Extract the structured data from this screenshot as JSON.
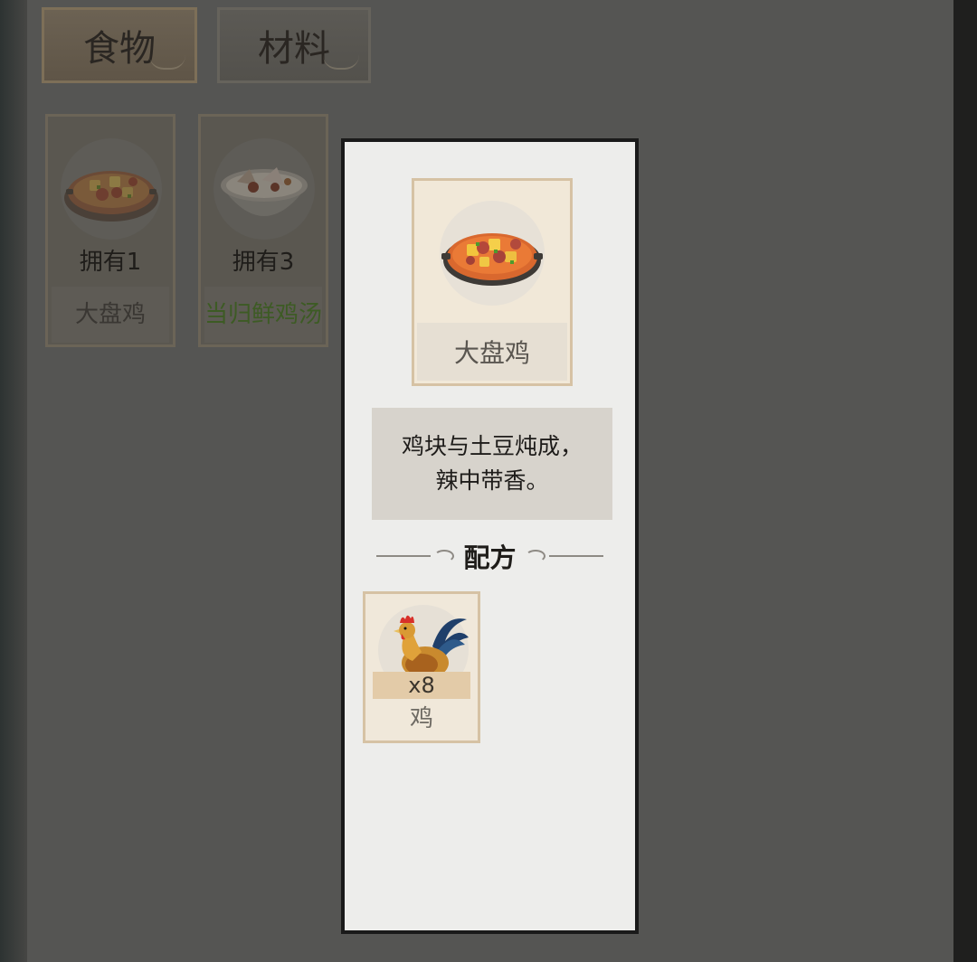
{
  "tabs": [
    {
      "label": "食物",
      "active": true
    },
    {
      "label": "材料",
      "active": false
    }
  ],
  "food_items": [
    {
      "owned": "拥有1",
      "name": "大盘鸡",
      "name_color": "#3a3733",
      "icon": "spicy-chicken-dish-icon"
    },
    {
      "owned": "拥有3",
      "name": "当归鲜鸡汤",
      "name_color": "#3d5b24",
      "icon": "angelica-chicken-soup-icon"
    }
  ],
  "detail": {
    "name": "大盘鸡",
    "icon": "spicy-chicken-dish-icon",
    "description_line1": "鸡块与土豆炖成，",
    "description_line2": "辣中带香。",
    "recipe_heading": "配方",
    "ingredients": [
      {
        "name": "鸡",
        "quantity": "x8",
        "icon": "rooster-icon"
      }
    ]
  },
  "colors": {
    "paper": "#ededeb",
    "card": "#f1e8d8",
    "card_border": "#d6c2a4",
    "green_name": "#3d5b24"
  }
}
